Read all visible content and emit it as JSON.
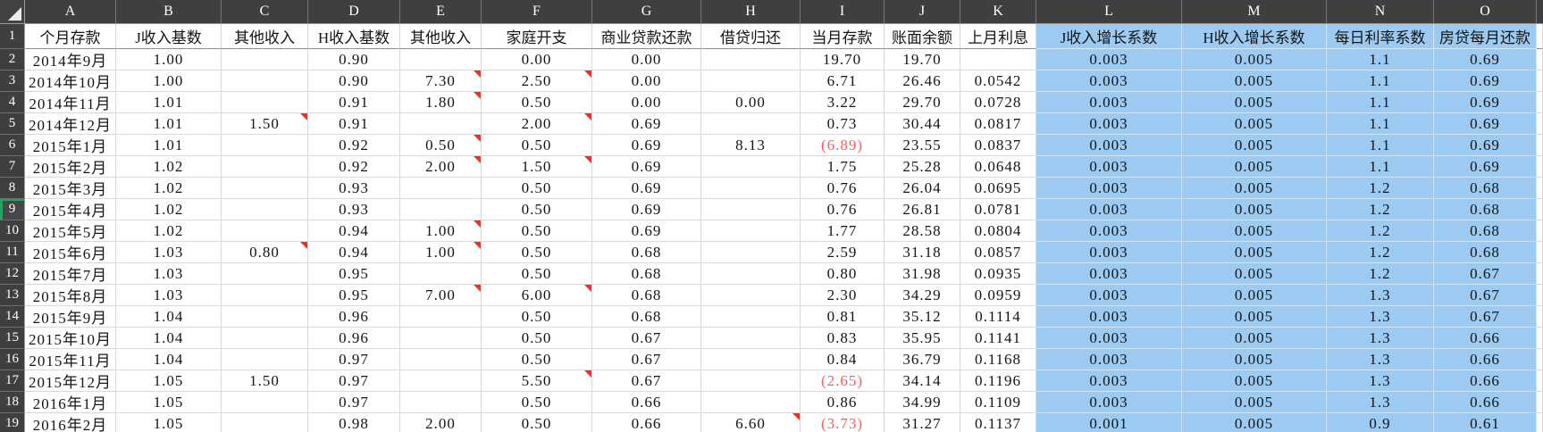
{
  "sheet": {
    "column_letters": [
      "A",
      "B",
      "C",
      "D",
      "E",
      "F",
      "G",
      "H",
      "I",
      "J",
      "K",
      "L",
      "M",
      "N",
      "O"
    ],
    "active_row": "9",
    "colors": {
      "blue_fill": "#9ccaf0",
      "negative_text": "#ff5a5a",
      "comment_marker": "#f92c1e",
      "header_bg": "#3f3f3f",
      "header_text": "#ffffff",
      "gridline": "#d8d8d8"
    },
    "header_row": {
      "number": "1",
      "cells": [
        "个月存款",
        "J收入基数",
        "其他收入",
        "H收入基数",
        "其他收入",
        "家庭开支",
        "商业贷款还款",
        "借贷归还",
        "当月存款",
        "账面余额",
        "上月利息",
        "J收入增长系数",
        "H收入增长系数",
        "每日利率系数",
        "房贷每月还款"
      ]
    },
    "rows": [
      {
        "number": "2",
        "cells": [
          "2014年9月",
          "1.00",
          "",
          "0.90",
          "",
          "0.00",
          "0.00",
          "",
          "19.70",
          "19.70",
          "",
          "0.003",
          "0.005",
          "1.1",
          "0.69"
        ],
        "markers": []
      },
      {
        "number": "3",
        "cells": [
          "2014年10月",
          "1.00",
          "",
          "0.90",
          "7.30",
          "2.50",
          "0.00",
          "",
          "6.71",
          "26.46",
          "0.0542",
          "0.003",
          "0.005",
          "1.1",
          "0.69"
        ],
        "markers": [
          "E",
          "F"
        ]
      },
      {
        "number": "4",
        "cells": [
          "2014年11月",
          "1.01",
          "",
          "0.91",
          "1.80",
          "0.50",
          "0.00",
          "0.00",
          "3.22",
          "29.70",
          "0.0728",
          "0.003",
          "0.005",
          "1.1",
          "0.69"
        ],
        "markers": [
          "E"
        ]
      },
      {
        "number": "5",
        "cells": [
          "2014年12月",
          "1.01",
          "1.50",
          "0.91",
          "",
          "2.00",
          "0.69",
          "",
          "0.73",
          "30.44",
          "0.0817",
          "0.003",
          "0.005",
          "1.1",
          "0.69"
        ],
        "markers": [
          "C",
          "F"
        ]
      },
      {
        "number": "6",
        "cells": [
          "2015年1月",
          "1.01",
          "",
          "0.92",
          "0.50",
          "0.50",
          "0.69",
          "8.13",
          "(6.89)",
          "23.55",
          "0.0837",
          "0.003",
          "0.005",
          "1.1",
          "0.69"
        ],
        "markers": [
          "E"
        ]
      },
      {
        "number": "7",
        "cells": [
          "2015年2月",
          "1.02",
          "",
          "0.92",
          "2.00",
          "1.50",
          "0.69",
          "",
          "1.75",
          "25.28",
          "0.0648",
          "0.003",
          "0.005",
          "1.1",
          "0.69"
        ],
        "markers": [
          "E",
          "F"
        ]
      },
      {
        "number": "8",
        "cells": [
          "2015年3月",
          "1.02",
          "",
          "0.93",
          "",
          "0.50",
          "0.69",
          "",
          "0.76",
          "26.04",
          "0.0695",
          "0.003",
          "0.005",
          "1.2",
          "0.68"
        ],
        "markers": []
      },
      {
        "number": "9",
        "cells": [
          "2015年4月",
          "1.02",
          "",
          "0.93",
          "",
          "0.50",
          "0.69",
          "",
          "0.76",
          "26.81",
          "0.0781",
          "0.003",
          "0.005",
          "1.2",
          "0.68"
        ],
        "markers": []
      },
      {
        "number": "10",
        "cells": [
          "2015年5月",
          "1.02",
          "",
          "0.94",
          "1.00",
          "0.50",
          "0.69",
          "",
          "1.77",
          "28.58",
          "0.0804",
          "0.003",
          "0.005",
          "1.2",
          "0.68"
        ],
        "markers": [
          "E"
        ]
      },
      {
        "number": "11",
        "cells": [
          "2015年6月",
          "1.03",
          "0.80",
          "0.94",
          "1.00",
          "0.50",
          "0.68",
          "",
          "2.59",
          "31.18",
          "0.0857",
          "0.003",
          "0.005",
          "1.2",
          "0.68"
        ],
        "markers": [
          "C",
          "E"
        ]
      },
      {
        "number": "12",
        "cells": [
          "2015年7月",
          "1.03",
          "",
          "0.95",
          "",
          "0.50",
          "0.68",
          "",
          "0.80",
          "31.98",
          "0.0935",
          "0.003",
          "0.005",
          "1.2",
          "0.67"
        ],
        "markers": []
      },
      {
        "number": "13",
        "cells": [
          "2015年8月",
          "1.03",
          "",
          "0.95",
          "7.00",
          "6.00",
          "0.68",
          "",
          "2.30",
          "34.29",
          "0.0959",
          "0.003",
          "0.005",
          "1.3",
          "0.67"
        ],
        "markers": [
          "E",
          "F"
        ]
      },
      {
        "number": "14",
        "cells": [
          "2015年9月",
          "1.04",
          "",
          "0.96",
          "",
          "0.50",
          "0.68",
          "",
          "0.81",
          "35.12",
          "0.1114",
          "0.003",
          "0.005",
          "1.3",
          "0.67"
        ],
        "markers": []
      },
      {
        "number": "15",
        "cells": [
          "2015年10月",
          "1.04",
          "",
          "0.96",
          "",
          "0.50",
          "0.67",
          "",
          "0.83",
          "35.95",
          "0.1141",
          "0.003",
          "0.005",
          "1.3",
          "0.66"
        ],
        "markers": []
      },
      {
        "number": "16",
        "cells": [
          "2015年11月",
          "1.04",
          "",
          "0.97",
          "",
          "0.50",
          "0.67",
          "",
          "0.84",
          "36.79",
          "0.1168",
          "0.003",
          "0.005",
          "1.3",
          "0.66"
        ],
        "markers": []
      },
      {
        "number": "17",
        "cells": [
          "2015年12月",
          "1.05",
          "1.50",
          "0.97",
          "",
          "5.50",
          "0.67",
          "",
          "(2.65)",
          "34.14",
          "0.1196",
          "0.003",
          "0.005",
          "1.3",
          "0.66"
        ],
        "markers": [
          "F"
        ]
      },
      {
        "number": "18",
        "cells": [
          "2016年1月",
          "1.05",
          "",
          "0.97",
          "",
          "0.50",
          "0.66",
          "",
          "0.86",
          "34.99",
          "0.1109",
          "0.003",
          "0.005",
          "1.3",
          "0.66"
        ],
        "markers": []
      },
      {
        "number": "19",
        "cells": [
          "2016年2月",
          "1.05",
          "",
          "0.98",
          "2.00",
          "0.50",
          "0.66",
          "6.60",
          "(3.73)",
          "31.27",
          "0.1137",
          "0.001",
          "0.005",
          "0.9",
          "0.61"
        ],
        "markers": [
          "H"
        ]
      }
    ]
  }
}
